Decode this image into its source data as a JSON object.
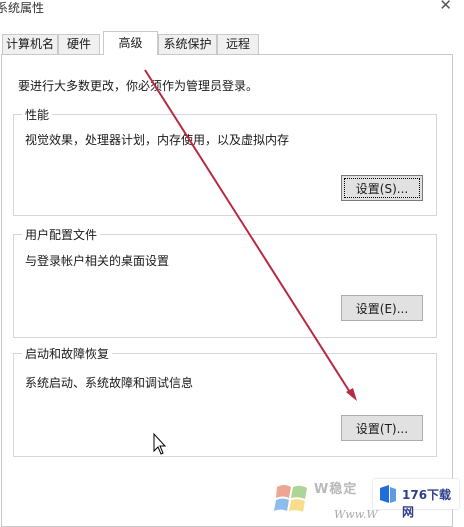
{
  "window": {
    "title": "系统属性",
    "close_glyph": "✕"
  },
  "tabs": [
    {
      "label": "计算机名",
      "active": false
    },
    {
      "label": "硬件",
      "active": false
    },
    {
      "label": "高级",
      "active": true
    },
    {
      "label": "系统保护",
      "active": false
    },
    {
      "label": "远程",
      "active": false
    }
  ],
  "main": {
    "intro": "要进行大多数更改，你必须作为管理员登录。",
    "groups": [
      {
        "title": "性能",
        "description": "视觉效果，处理器计划，内存使用，以及虚拟内存",
        "button": "设置(S)..."
      },
      {
        "title": "用户配置文件",
        "description": "与登录帐户相关的桌面设置",
        "button": "设置(E)..."
      },
      {
        "title": "启动和故障恢复",
        "description": "系统启动、系统故障和调试信息",
        "button": "设置(T)..."
      }
    ]
  },
  "annotation": {
    "arrow_color": "#b82a43",
    "cursor_icon": "mouse-pointer-icon"
  },
  "watermark": {
    "logo_text": "W稳定",
    "url_text": "Www.W",
    "badge_text": "176下载网"
  },
  "colors": {
    "border": "#c9c9c9",
    "tab_inactive_bg": "#f0f0f0",
    "button_bg": "#e1e1e1",
    "badge_blue": "#1e6fd9",
    "badge_text": "#2e3f8c"
  }
}
